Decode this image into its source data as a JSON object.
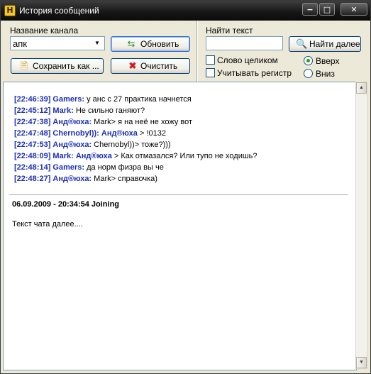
{
  "window": {
    "title": "История сообщений"
  },
  "channel": {
    "label": "Название канала",
    "value": "апк"
  },
  "buttons": {
    "refresh": "Обновить",
    "save_as": "Сохранить как ...",
    "clear": "Очистить",
    "find_next": "Найти далее"
  },
  "search": {
    "label": "Найти текст",
    "value": ""
  },
  "options": {
    "whole_word": "Слово целиком",
    "match_case": "Учитывать регистр",
    "dir_up": "Вверх",
    "dir_down": "Вниз"
  },
  "messages": [
    {
      "time": "[22:46:39]",
      "nick": "Gamers:",
      "text": " у анс с 27 практика начнется"
    },
    {
      "time": "[22:45:12]",
      "nick": "Mark:",
      "text": " Не сильно ганяют?"
    },
    {
      "time": "[22:47:38]",
      "nick": "Анд®юха:",
      "text": " Mark> я на неё не хожу вот"
    },
    {
      "time": "[22:47:48]",
      "nick": "Chernobyl)):",
      "text": "",
      "mention": "Анд®юха",
      "tail": " > !0132"
    },
    {
      "time": "[22:47:53]",
      "nick": "Анд®юха:",
      "text": " Chernobyl))> тоже?)))"
    },
    {
      "time": "[22:48:09]",
      "nick": "Mark:",
      "text": "",
      "mention": "Анд®юха",
      "tail": " > Как отмазался? Или тупо не ходишь?"
    },
    {
      "time": "[22:48:14]",
      "nick": "Gamers:",
      "text": "  да норм физра вы че"
    },
    {
      "time": "[22:48:27]",
      "nick": "Анд®юха:",
      "text": " Mark> справочка)"
    }
  ],
  "joining": "06.09.2009 - 20:34:54 Joining",
  "continued": "Текст чата далее...."
}
